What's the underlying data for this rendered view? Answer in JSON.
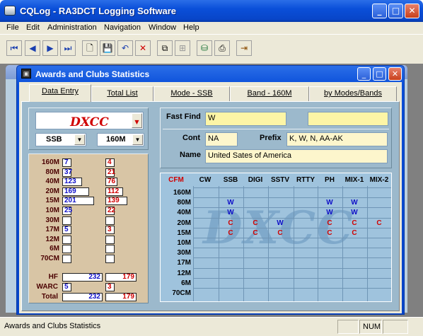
{
  "app": {
    "title": "CQLog - RA3DCT Logging Software"
  },
  "menu": [
    "File",
    "Edit",
    "Administration",
    "Navigation",
    "Window",
    "Help"
  ],
  "child": {
    "title": "Awards and Clubs Statistics"
  },
  "tabs": [
    "Data Entry",
    "Total List",
    "Mode - SSB",
    "Band - 160M",
    "by Modes/Bands"
  ],
  "award": {
    "selected": "DXCC",
    "mode": "SSB",
    "band": "160M"
  },
  "fastfind": {
    "label": "Fast Find",
    "value": "W",
    "value2": ""
  },
  "cont": {
    "label": "Cont",
    "value": "NA"
  },
  "prefix": {
    "label": "Prefix",
    "value": "K, W, N, AA-AK"
  },
  "name": {
    "label": "Name",
    "value": "United Sates of America"
  },
  "bandstats": {
    "bands": [
      "160M",
      "80M",
      "40M",
      "20M",
      "15M",
      "10M",
      "30M",
      "17M",
      "12M",
      "6M",
      "70CM"
    ],
    "blue": [
      "7",
      "37",
      "123",
      "169",
      "201",
      "25",
      "",
      "5",
      "",
      "",
      ""
    ],
    "red": [
      "4",
      "21",
      "76",
      "112",
      "139",
      "22",
      "",
      "3",
      "",
      "",
      ""
    ],
    "summary": [
      {
        "label": "HF",
        "blue": "232",
        "red": "179"
      },
      {
        "label": "WARC",
        "blue": "5",
        "red": "3"
      },
      {
        "label": "Total",
        "blue": "232",
        "red": "179"
      }
    ]
  },
  "grid": {
    "corner": "CFM",
    "cols": [
      "CW",
      "SSB",
      "DIGI",
      "SSTV",
      "RTTY",
      "PH",
      "MIX-1",
      "MIX-2"
    ],
    "rows": [
      "160M",
      "80M",
      "40M",
      "20M",
      "15M",
      "10M",
      "30M",
      "17M",
      "12M",
      "6M",
      "70CM"
    ],
    "watermark": "DXCC",
    "cells": [
      {
        "row": 1,
        "col": 1,
        "v": "W",
        "color": "#1010c8"
      },
      {
        "row": 1,
        "col": 5,
        "v": "W",
        "color": "#1010c8"
      },
      {
        "row": 1,
        "col": 6,
        "v": "W",
        "color": "#1010c8"
      },
      {
        "row": 2,
        "col": 1,
        "v": "W",
        "color": "#1010c8"
      },
      {
        "row": 2,
        "col": 5,
        "v": "W",
        "color": "#1010c8"
      },
      {
        "row": 2,
        "col": 6,
        "v": "W",
        "color": "#1010c8"
      },
      {
        "row": 3,
        "col": 1,
        "v": "C",
        "color": "#d00000"
      },
      {
        "row": 3,
        "col": 2,
        "v": "C",
        "color": "#d00000"
      },
      {
        "row": 3,
        "col": 3,
        "v": "W",
        "color": "#1010c8"
      },
      {
        "row": 3,
        "col": 5,
        "v": "C",
        "color": "#d00000"
      },
      {
        "row": 3,
        "col": 6,
        "v": "C",
        "color": "#d00000"
      },
      {
        "row": 3,
        "col": 7,
        "v": "C",
        "color": "#d00000"
      },
      {
        "row": 4,
        "col": 1,
        "v": "C",
        "color": "#d00000"
      },
      {
        "row": 4,
        "col": 2,
        "v": "C",
        "color": "#d00000"
      },
      {
        "row": 4,
        "col": 3,
        "v": "C",
        "color": "#d00000"
      },
      {
        "row": 4,
        "col": 5,
        "v": "C",
        "color": "#d00000"
      },
      {
        "row": 4,
        "col": 6,
        "v": "C",
        "color": "#d00000"
      }
    ]
  },
  "status": {
    "text": "Awards and Clubs Statistics",
    "num": "NUM"
  }
}
